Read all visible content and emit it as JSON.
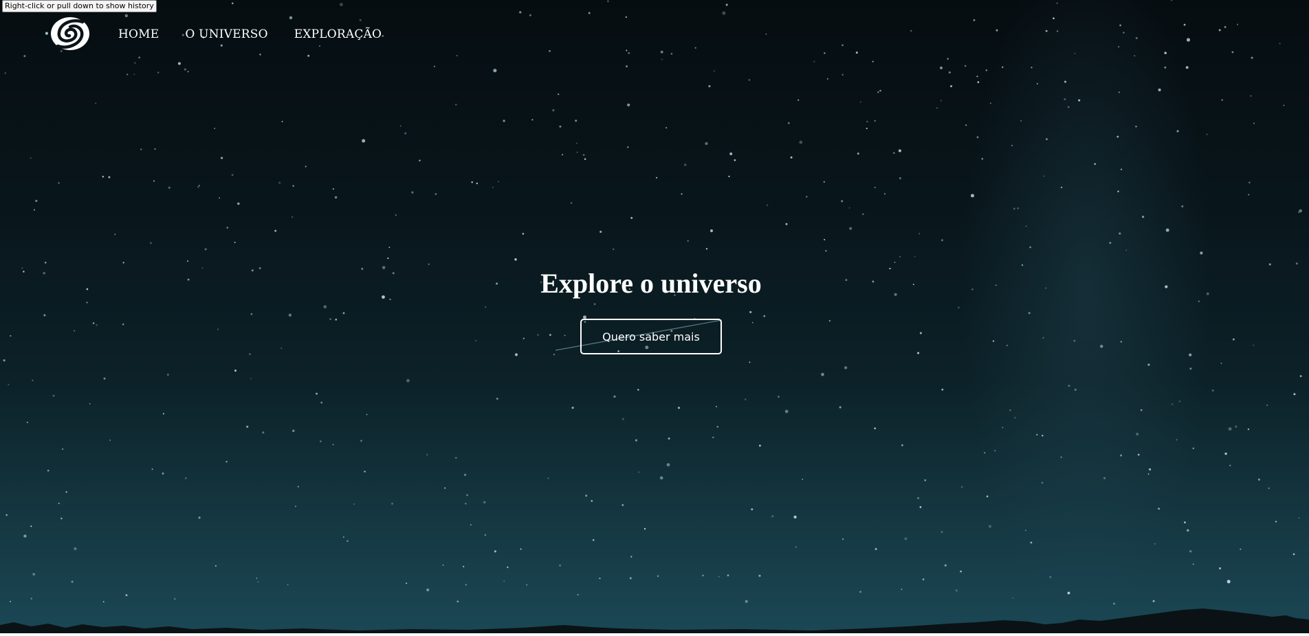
{
  "tooltip": {
    "text": "Right-click or pull down to show history"
  },
  "header": {
    "logo_icon": "spiral-galaxy-icon",
    "nav": [
      {
        "label": "HOME"
      },
      {
        "label": "O UNIVERSO"
      },
      {
        "label": "EXPLORAÇÃO"
      }
    ]
  },
  "hero": {
    "title": "Explore o universo",
    "button_label": "Quero saber mais",
    "background": "night-sky-starfield"
  },
  "colors": {
    "text": "#ffffff",
    "sky_top": "#060d11",
    "sky_bottom": "#1b4754"
  }
}
